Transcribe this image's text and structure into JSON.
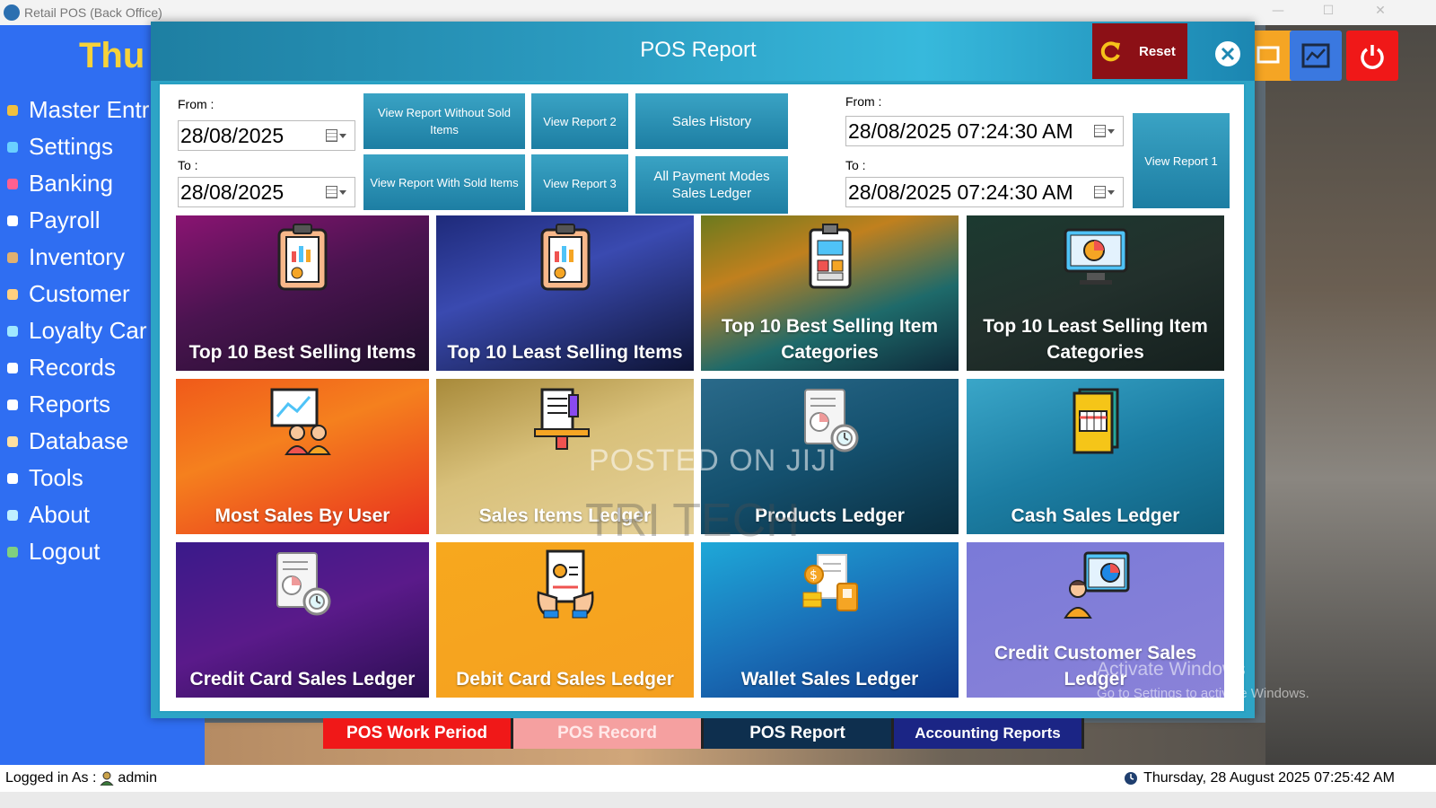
{
  "window": {
    "title": "Retail POS (Back Office)"
  },
  "brand": "Thu",
  "sidebar": {
    "items": [
      {
        "label": "Master Entr",
        "icon": "master-entry-icon",
        "color": "#f0c040"
      },
      {
        "label": "Settings",
        "icon": "settings-icon",
        "color": "#6ad0ff"
      },
      {
        "label": "Banking",
        "icon": "banking-icon",
        "color": "#ff6090"
      },
      {
        "label": "Payroll",
        "icon": "payroll-icon",
        "color": "#ffffff"
      },
      {
        "label": "Inventory",
        "icon": "inventory-icon",
        "color": "#e0b070"
      },
      {
        "label": "Customer",
        "icon": "customer-icon",
        "color": "#ffd080"
      },
      {
        "label": "Loyalty Car",
        "icon": "loyalty-card-icon",
        "color": "#a0e8ff"
      },
      {
        "label": "Records",
        "icon": "records-icon",
        "color": "#ffffff"
      },
      {
        "label": "Reports",
        "icon": "reports-icon",
        "color": "#ffffff"
      },
      {
        "label": "Database",
        "icon": "database-icon",
        "color": "#ffe0a0"
      },
      {
        "label": "Tools",
        "icon": "tools-icon",
        "color": "#ffffff"
      },
      {
        "label": "About",
        "icon": "about-icon",
        "color": "#c0f0ff"
      },
      {
        "label": "Logout",
        "icon": "logout-icon",
        "color": "#80d080"
      }
    ]
  },
  "modal": {
    "title": "POS Report",
    "reset_label": "Reset",
    "left_range": {
      "from_label": "From :",
      "from_value": "28/08/2025",
      "to_label": "To :",
      "to_value": "28/08/2025"
    },
    "right_range": {
      "from_label": "From :",
      "from_value": "28/08/2025 07:24:30 AM",
      "to_label": "To :",
      "to_value": "28/08/2025 07:24:30 AM"
    },
    "buttons": {
      "without_sold": "View Report Without Sold Items",
      "with_sold": "View Report With Sold Items",
      "report2": "View Report 2",
      "report3": "View Report 3",
      "sales_history": "Sales History",
      "all_payment": "All Payment Modes Sales Ledger",
      "report1": "View Report 1"
    },
    "tiles": [
      {
        "label": "Top 10 Best Selling Items",
        "icon": "clipboard-chart-icon"
      },
      {
        "label": "Top 10 Least Selling Items",
        "icon": "clipboard-chart-icon"
      },
      {
        "label": "Top 10 Best Selling Item Categories",
        "icon": "report-calculator-icon"
      },
      {
        "label": "Top 10 Least Selling Item Categories",
        "icon": "monitor-analytics-icon"
      },
      {
        "label": "Most Sales By User",
        "icon": "users-presentation-icon"
      },
      {
        "label": "Sales Items Ledger",
        "icon": "document-chart-icon"
      },
      {
        "label": "Products Ledger",
        "icon": "document-clock-icon"
      },
      {
        "label": "Cash Sales Ledger",
        "icon": "ledger-book-icon"
      },
      {
        "label": "Credit Card Sales Ledger",
        "icon": "document-clock-icon"
      },
      {
        "label": "Debit Card Sales Ledger",
        "icon": "hands-document-icon"
      },
      {
        "label": "Wallet Sales Ledger",
        "icon": "wallet-coins-icon"
      },
      {
        "label": "Credit Customer Sales Ledger",
        "icon": "customer-chart-icon"
      }
    ]
  },
  "tabs": [
    {
      "label": "POS Work Period",
      "bg": "#f01818",
      "fg": "#ffffff"
    },
    {
      "label": "POS Record",
      "bg": "#f5a0a0",
      "fg": "#ffe8e8"
    },
    {
      "label": "POS Report",
      "bg": "#0e2f4e",
      "fg": "#ffffff"
    },
    {
      "label": "Accounting Reports",
      "bg": "#1b2585",
      "fg": "#ffffff"
    }
  ],
  "status": {
    "logged_in_label": "Logged in As :",
    "user": "admin",
    "datetime": "Thursday, 28 August 2025 07:25:42 AM"
  },
  "overlays": {
    "watermark1": "POSTED ON JIJI",
    "watermark2": "TRI TECH",
    "activate_title": "Activate Windows",
    "activate_sub": "Go to Settings to activate Windows."
  }
}
